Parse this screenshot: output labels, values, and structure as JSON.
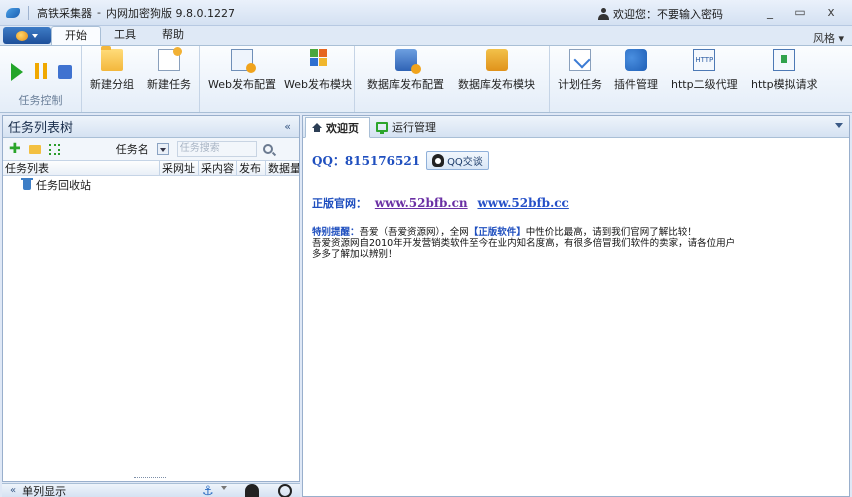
{
  "titlebar": {
    "app_name": "高铁采集器",
    "title": "内网加密狗版 9.8.0.1227",
    "separator": "-",
    "welcome": "欢迎您：不要输入密码",
    "min": "_",
    "max": "▭",
    "close": "x"
  },
  "ribbon_tabs": [
    "开始",
    "工具",
    "帮助"
  ],
  "style_menu": "风格 ▾",
  "ribbon": {
    "group_task_control": "任务控制",
    "buttons": [
      "新建分组",
      "新建任务",
      "Web发布配置",
      "Web发布模块",
      "数据库发布配置",
      "数据库发布模块",
      "计划任务",
      "插件管理",
      "http二级代理",
      "http模拟请求"
    ],
    "http_icon_text": "HTTP"
  },
  "left_panel": {
    "title": "任务列表树",
    "collapse": "«",
    "search_label": "任务名",
    "search_placeholder": "任务搜索",
    "columns": [
      "任务列表",
      "采网址",
      "采内容",
      "发布",
      "数据量"
    ],
    "tree_items": [
      "任务回收站"
    ],
    "bottom_label": "单列显示"
  },
  "right_panel": {
    "tabs": [
      "欢迎页",
      "运行管理"
    ],
    "qq_label": "QQ：815176521",
    "qq_button": "QQ交谈",
    "site_label": "正版官网：",
    "site_link1": "www.52bfb.cn",
    "site_link2": "www.52bfb.cc",
    "notice_label": "特别提醒：",
    "notice_part1": "吾爱（吾爱资源网），全网",
    "notice_highlight": "【正版软件】",
    "notice_part2": "中性价比最高，请到我们官网了解比较！",
    "notice_line2": "吾爱资源网自2010年开发营销类软件至今在业内知名度高，有很多倍冒我们软件的卖家，请各位用户",
    "notice_line3": "多多了解加以辨别！"
  },
  "colors": {
    "accent_blue": "#1f4fbf",
    "link_purple": "#6a2fa4",
    "play_green": "#22a52a",
    "pause_orange": "#f0a800"
  }
}
